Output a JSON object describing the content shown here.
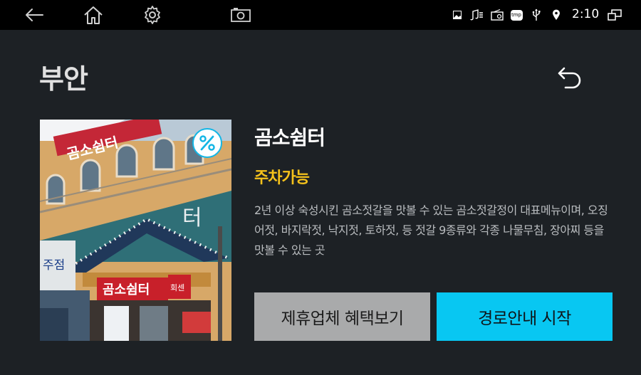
{
  "status_bar": {
    "time": "2:10",
    "nav_icons": [
      "back-icon",
      "home-icon",
      "settings-icon",
      "camera-icon"
    ],
    "status_icons": [
      "image-icon",
      "music-icon",
      "radio-icon",
      "tmap-icon",
      "usb-icon",
      "location-icon",
      "multi-window-icon"
    ],
    "tmap_label": "tmp"
  },
  "page": {
    "title": "부안"
  },
  "place": {
    "name": "곰소쉼터",
    "parking": "주차가능",
    "description": "2년 이상 숙성시킨 곰소젓갈을 맛볼 수 있는 곰소젓갈정이 대표메뉴이며,  오징어젓, 바지락젓, 낙지젓, 토하젓, 등 젓갈 9종류와 각종 나물무침, 장아찌 등을 맛볼 수 있는 곳",
    "photo_signs": {
      "roof_sign": "곰소쉼터",
      "store_sign": "곰소쉼터",
      "side_sign": "회센",
      "wall_text": "터",
      "left_text": "주점"
    }
  },
  "buttons": {
    "benefits": "제휴업체 혜택보기",
    "navigate": "경로안내 시작"
  },
  "colors": {
    "background": "#1d2125",
    "accent": "#08c7f2",
    "parking": "#f5c21b",
    "secondary_button": "#a9aaab"
  }
}
